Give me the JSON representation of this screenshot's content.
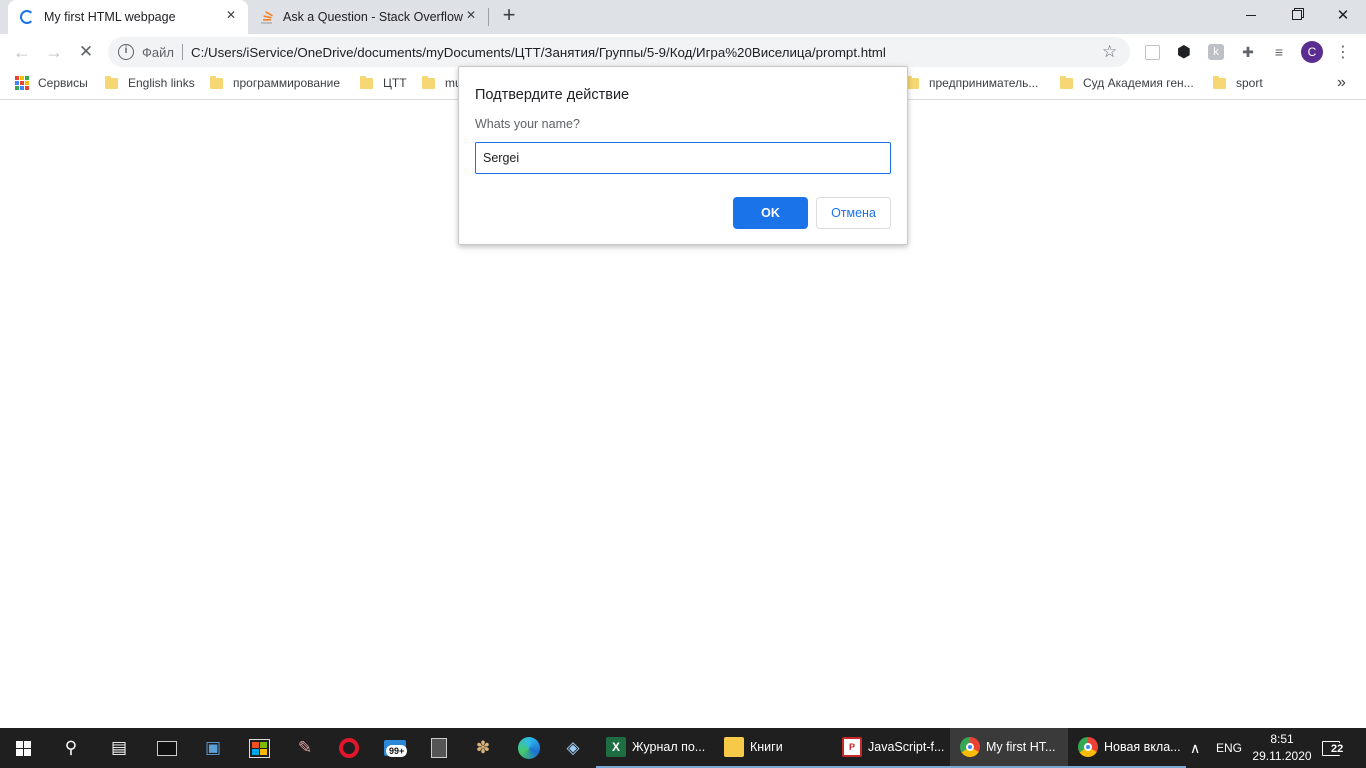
{
  "tabs": [
    {
      "title": "My first HTML webpage",
      "close": "✕",
      "active": true
    },
    {
      "title": "Ask a Question - Stack Overflow",
      "close": "✕",
      "active": false
    }
  ],
  "new_tab": "+",
  "window_controls": {
    "minimize": "—",
    "maximize": "❐",
    "close": "✕"
  },
  "omnibox": {
    "scheme_label": "Файл",
    "url": "C:/Users/iService/OneDrive/documents/myDocuments/ЦТТ/Занятия/Группы/5-9/Код/Игра%20Виселица/prompt.html"
  },
  "profile_initial": "C",
  "bookmarks": [
    {
      "label": "Сервисы",
      "type": "apps"
    },
    {
      "label": "English links",
      "type": "folder"
    },
    {
      "label": "программирование",
      "type": "folder"
    },
    {
      "label": "ЦТТ",
      "type": "folder"
    },
    {
      "label": "mu",
      "type": "folder"
    },
    {
      "label": "предприниматель...",
      "type": "folder"
    },
    {
      "label": "Суд Академия ген...",
      "type": "folder"
    },
    {
      "label": "sport",
      "type": "folder"
    }
  ],
  "bookmarks_overflow": "»",
  "dialog": {
    "title": "Подтвердите действие",
    "message": "Whats your name?",
    "input_value": "Sergei",
    "ok_label": "OK",
    "cancel_label": "Отмена"
  },
  "taskbar": {
    "apps": [
      {
        "label": "Журнал по...",
        "icon": "excel-icon",
        "glyph": "X",
        "color": "#1d6f42"
      },
      {
        "label": "Книги",
        "icon": "folder-icon",
        "glyph": "",
        "color": "#f7c948"
      },
      {
        "label": "JavaScript-f...",
        "icon": "pdf-icon",
        "glyph": "PDF",
        "color": "#c62828"
      },
      {
        "label": "My first HT...",
        "icon": "chrome-icon",
        "glyph": "",
        "color": "#4285f4",
        "active": true
      },
      {
        "label": "Новая вкла...",
        "icon": "chrome-icon",
        "glyph": "",
        "color": "#4285f4"
      }
    ],
    "mail_badge": "99+",
    "lang": "ENG",
    "time": "8:51",
    "date": "29.11.2020",
    "notifications": "22"
  },
  "colors": {
    "accent": "#1a73e8",
    "taskbar": "#1f1f1f",
    "tabstrip": "#dee1e6"
  }
}
